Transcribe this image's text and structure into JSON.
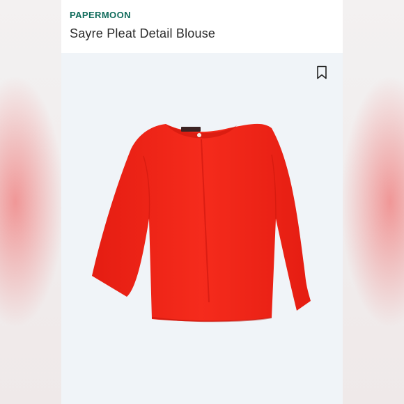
{
  "listing": {
    "brand": "PAPERMOON",
    "title": "Sayre Pleat Detail Blouse",
    "bookmark_icon": "bookmark-icon",
    "product_image": "red-blouse"
  },
  "colors": {
    "brand": "#0f6b5b",
    "garment": "#f4281a",
    "photo_bg": "#f0f4f8"
  }
}
